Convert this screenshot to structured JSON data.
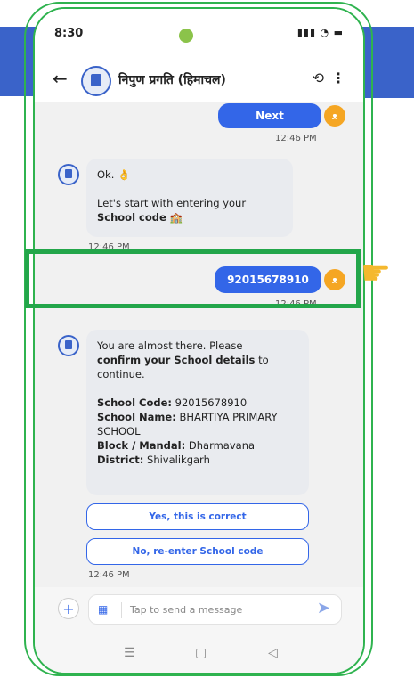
{
  "status": {
    "time": "8:30",
    "icons": "▮▮▮ ◔ ▬"
  },
  "appbar": {
    "back_icon": "←",
    "title": "निपुण प्रगति (हिमाचल)",
    "share_icon": "⟲",
    "menu_icon": "⋮"
  },
  "messages": {
    "next_label": "Next",
    "next_time": "12:46 PM",
    "bot1_line1": "Ok. 👌",
    "bot1_line2": "Let's start with entering your",
    "bot1_bold": "School code",
    "bot1_emoji": "🏫",
    "bot1_time": "12:46 PM",
    "school_code_sent": "92015678910",
    "school_code_time": "12:46 PM",
    "bot2_line1": "You are almost there. Please",
    "bot2_bold": "confirm your School details",
    "bot2_rest": "to continue.",
    "code_label": "School Code:",
    "code_value": "92015678910",
    "name_label": "School Name:",
    "name_value": "BHARTIYA PRIMARY SCHOOL",
    "block_label": "Block / Mandal:",
    "block_value": "Dharmavana",
    "district_label": "District:",
    "district_value": "Shivalikgarh",
    "yes_button": "Yes, this is correct",
    "no_button": "No, re-enter School code",
    "bot2_time": "12:46 PM"
  },
  "composer": {
    "placeholder": "Tap to send a message",
    "plus_icon": "+",
    "grid_icon": "▦",
    "send_icon": "➤"
  },
  "navbar": {
    "recent": "☰",
    "home": "▢",
    "back": "◁"
  },
  "user_avatar_icon": "ᴥ",
  "pointer_icon": "☛",
  "colors": {
    "accent": "#3366e8",
    "highlight": "#23a64a",
    "banner": "#3a63c9"
  }
}
